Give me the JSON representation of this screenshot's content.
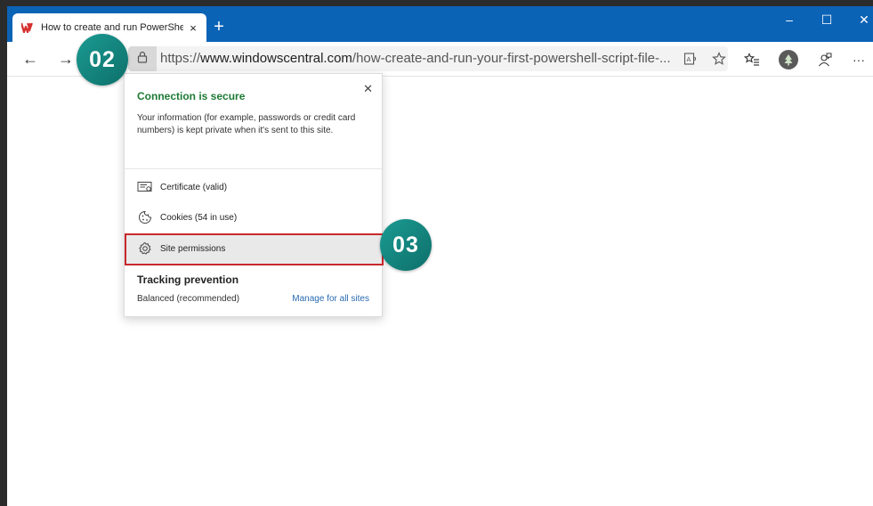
{
  "browser": {
    "tab": {
      "title": "How to create and run PowerShe",
      "close": "×"
    },
    "new_tab": "+",
    "window_controls": {
      "minimize": "–",
      "maximize": "☐",
      "close": "✕"
    },
    "nav": {
      "back": "←",
      "forward": "→"
    },
    "address_bar": {
      "scheme": "https://",
      "host": "www.windowscentral.com",
      "path": "/how-create-and-run-your-first-powershell-script-file-..."
    },
    "more_menu": "···"
  },
  "badges": {
    "step_02": "02",
    "step_03": "03"
  },
  "site_info_popup": {
    "close": "✕",
    "connection_title": "Connection is secure",
    "connection_desc": "Your information (for example, passwords or credit card numbers) is kept private when it's sent to this site.",
    "items": [
      {
        "label": "Certificate (valid)",
        "icon": "certificate-icon"
      },
      {
        "label": "Cookies (54 in use)",
        "icon": "cookie-icon"
      },
      {
        "label": "Site permissions",
        "icon": "gear-icon"
      }
    ],
    "tracking_title": "Tracking prevention",
    "tracking_value": "Balanced (recommended)",
    "tracking_link": "Manage for all sites"
  },
  "colors": {
    "titlebar": "#0b63b6",
    "secure_green": "#1e7a35",
    "highlight_red": "#c8282d",
    "badge_teal": "#138580",
    "link_blue": "#2a6bb0"
  }
}
